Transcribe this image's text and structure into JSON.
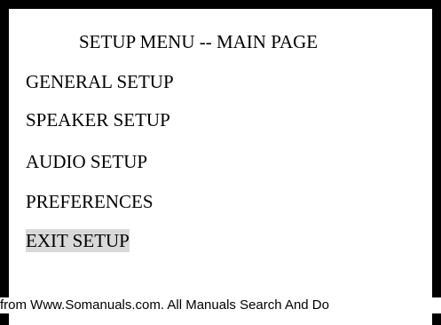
{
  "menu": {
    "title": "SETUP MENU -- MAIN PAGE",
    "items": [
      {
        "label": "GENERAL SETUP",
        "selected": false
      },
      {
        "label": "SPEAKER SETUP",
        "selected": false
      },
      {
        "label": "AUDIO SETUP",
        "selected": false
      },
      {
        "label": "PREFERENCES",
        "selected": false
      },
      {
        "label": "EXIT SETUP",
        "selected": true
      }
    ]
  },
  "footer": {
    "text": "from Www.Somanuals.com. All Manuals Search And Do"
  },
  "colors": {
    "border": "#000000",
    "background": "#ffffff",
    "highlight": "#d9d9d9",
    "text": "#000000"
  }
}
